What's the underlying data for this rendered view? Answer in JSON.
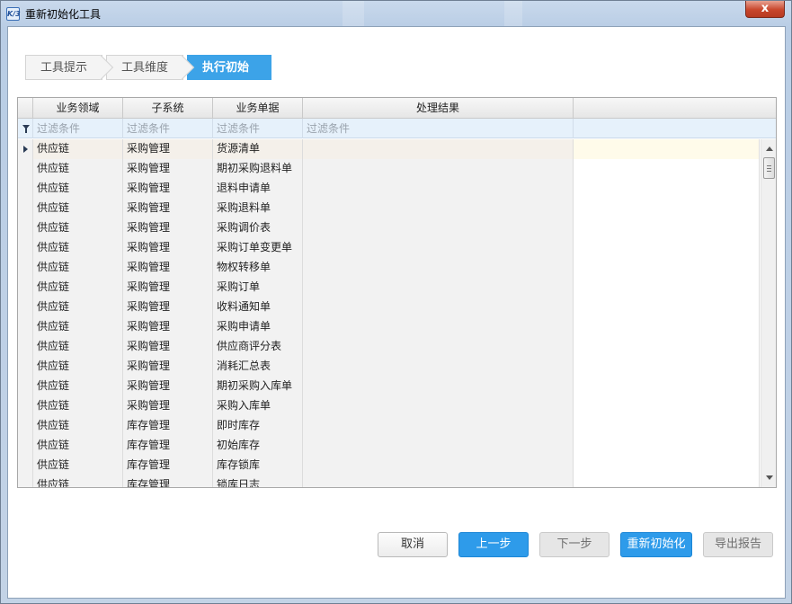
{
  "window": {
    "title": "重新初始化工具",
    "icon_label": "K/3",
    "close_label": "x"
  },
  "steps": [
    {
      "label": "工具提示",
      "active": false
    },
    {
      "label": "工具维度",
      "active": false
    },
    {
      "label": "执行初始化",
      "active": true
    }
  ],
  "grid": {
    "columns": [
      "业务领域",
      "子系统",
      "业务单据",
      "处理结果"
    ],
    "filter_placeholder": "过滤条件",
    "rows": [
      [
        "供应链",
        "采购管理",
        "货源清单",
        ""
      ],
      [
        "供应链",
        "采购管理",
        "期初采购退料单",
        ""
      ],
      [
        "供应链",
        "采购管理",
        "退料申请单",
        ""
      ],
      [
        "供应链",
        "采购管理",
        "采购退料单",
        ""
      ],
      [
        "供应链",
        "采购管理",
        "采购调价表",
        ""
      ],
      [
        "供应链",
        "采购管理",
        "采购订单变更单",
        ""
      ],
      [
        "供应链",
        "采购管理",
        "物权转移单",
        ""
      ],
      [
        "供应链",
        "采购管理",
        "采购订单",
        ""
      ],
      [
        "供应链",
        "采购管理",
        "收料通知单",
        ""
      ],
      [
        "供应链",
        "采购管理",
        "采购申请单",
        ""
      ],
      [
        "供应链",
        "采购管理",
        "供应商评分表",
        ""
      ],
      [
        "供应链",
        "采购管理",
        "消耗汇总表",
        ""
      ],
      [
        "供应链",
        "采购管理",
        "期初采购入库单",
        ""
      ],
      [
        "供应链",
        "采购管理",
        "采购入库单",
        ""
      ],
      [
        "供应链",
        "库存管理",
        "即时库存",
        ""
      ],
      [
        "供应链",
        "库存管理",
        "初始库存",
        ""
      ],
      [
        "供应链",
        "库存管理",
        "库存锁库",
        ""
      ],
      [
        "供应链",
        "库存管理",
        "锁库日志",
        ""
      ]
    ]
  },
  "buttons": {
    "cancel": "取消",
    "previous": "上一步",
    "next": "下一步",
    "reinit": "重新初始化",
    "export": "导出报告"
  }
}
